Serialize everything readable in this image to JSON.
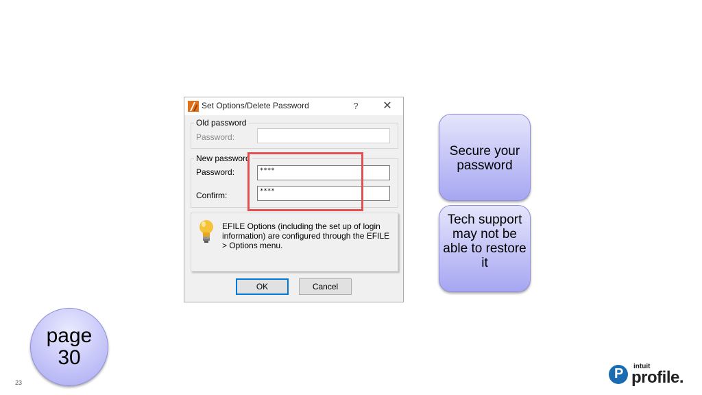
{
  "dialog": {
    "title": "Set Options/Delete Password",
    "help_glyph": "?",
    "close_glyph": "✕",
    "old_password": {
      "group_label": "Old password",
      "password_label": "Password:",
      "password_value": ""
    },
    "new_password": {
      "group_label": "New password",
      "password_label": "Password:",
      "password_value": "****",
      "confirm_label": "Confirm:",
      "confirm_value": "****"
    },
    "info_text": "EFILE Options (including the set up of login information) are configured through the EFILE > Options menu.",
    "ok_label": "OK",
    "cancel_label": "Cancel"
  },
  "callouts": {
    "secure": "Secure your password",
    "tech_support": "Tech support may not be able to restore it"
  },
  "page_ref": {
    "line1": "page",
    "line2": "30"
  },
  "slide_number": "23",
  "logo": {
    "brand_small": "intuit",
    "brand_large": "profile."
  },
  "colors": {
    "highlight": "#e05050",
    "callout_fill": "#a6a6f2",
    "logo_blue": "#1a6bb0",
    "default_button_border": "#0078d7"
  }
}
